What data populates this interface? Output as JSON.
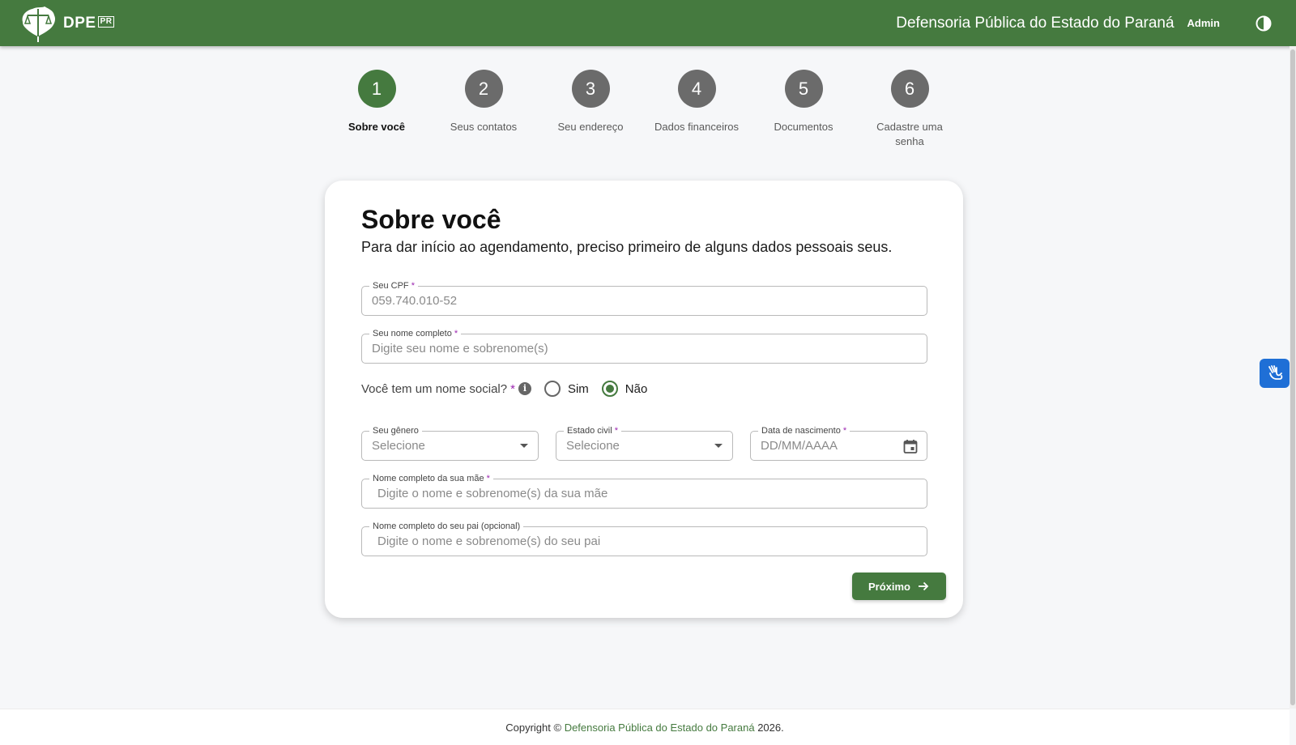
{
  "header": {
    "logo_text": "DPE",
    "logo_badge": "PR",
    "org_name": "Defensoria Pública do Estado do Paraná",
    "admin_label": "Admin",
    "contrast_icon": "contrast-icon",
    "brand_color": "#457a3f"
  },
  "stepper": {
    "steps": [
      {
        "number": "1",
        "label": "Sobre você",
        "active": true
      },
      {
        "number": "2",
        "label": "Seus contatos",
        "active": false
      },
      {
        "number": "3",
        "label": "Seu endereço",
        "active": false
      },
      {
        "number": "4",
        "label": "Dados financeiros",
        "active": false
      },
      {
        "number": "5",
        "label": "Documentos",
        "active": false
      },
      {
        "number": "6",
        "label": "Cadastre uma senha",
        "active": false
      }
    ]
  },
  "form": {
    "title": "Sobre você",
    "subtitle": "Para dar início ao agendamento, preciso primeiro de alguns dados pessoais seus.",
    "required_mark": "*",
    "cpf": {
      "label": "Seu CPF",
      "value": "059.740.010-52"
    },
    "full_name": {
      "label": "Seu nome completo",
      "placeholder": "Digite seu nome e sobrenome(s)"
    },
    "social_name": {
      "question": "Você tem um nome social?",
      "info_icon": "info-icon",
      "options": [
        {
          "label": "Sim",
          "checked": false
        },
        {
          "label": "Não",
          "checked": true
        }
      ]
    },
    "gender": {
      "label": "Seu gênero",
      "value": "Selecione"
    },
    "marital_status": {
      "label": "Estado civil",
      "value": "Selecione"
    },
    "birth_date": {
      "label": "Data de nascimento",
      "placeholder": "DD/MM/AAAA"
    },
    "mother_name": {
      "label": "Nome completo da sua mãe",
      "placeholder": "Digite o nome e sobrenome(s) da sua mãe"
    },
    "father_name": {
      "label": "Nome completo do seu pai (opcional)",
      "placeholder": "Digite o nome e sobrenome(s) do seu pai"
    },
    "next_button": "Próximo"
  },
  "footer": {
    "prefix": "Copyright ©",
    "link_text": "Defensoria Pública do Estado do Paraná",
    "year": "2026."
  }
}
